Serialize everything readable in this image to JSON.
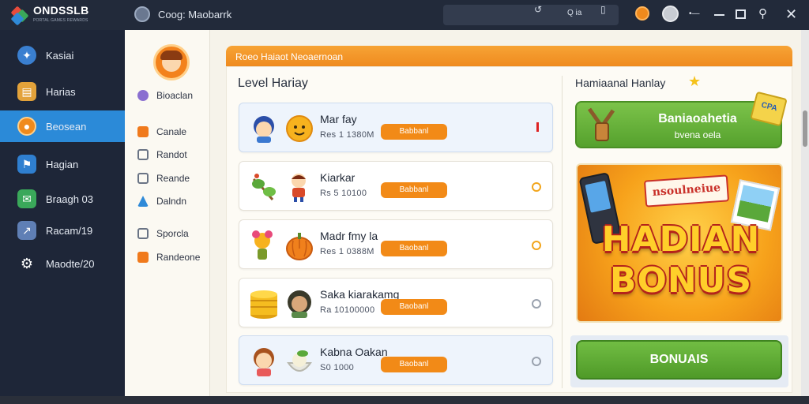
{
  "app": {
    "logo_name": "ONDSSLB",
    "logo_sub": "PORTAL GAMES REWARDS",
    "tab_title": "Coog: Maobarrk",
    "search_text": "Q ia"
  },
  "nav": {
    "items": [
      {
        "label": "Kasiai",
        "icon": "gamepad-icon",
        "color": "#3a7fd0"
      },
      {
        "label": "Harias",
        "icon": "chest-icon",
        "color": "#e3a23a"
      },
      {
        "label": "Beosean",
        "icon": "coin-icon",
        "color": "#f08a1c",
        "active": true
      },
      {
        "label": "Hagian",
        "icon": "flag-icon",
        "color": "#2f7fd0"
      },
      {
        "label": "Braagh 03",
        "icon": "mail-icon",
        "color": "#3aa85a"
      },
      {
        "label": "Racam/19",
        "icon": "chart-icon",
        "color": "#6a8cc0"
      },
      {
        "label": "Maodte/20",
        "icon": "gear-icon",
        "color": "#e6ebf3"
      }
    ]
  },
  "sub": {
    "items": [
      {
        "label": "Bioaclan",
        "icon": "profile-icon",
        "color": "#8a6fd0"
      },
      {
        "label": "Canale",
        "icon": "star-icon",
        "color": "#f07a1c"
      },
      {
        "label": "Randot",
        "icon": "doc-icon",
        "color": "#6a7485"
      },
      {
        "label": "Reande",
        "icon": "list-icon",
        "color": "#6a7485"
      },
      {
        "label": "Dalndn",
        "icon": "triangle-icon",
        "color": "#2f8ad8"
      },
      {
        "label": "Sporcla",
        "icon": "bar-icon",
        "color": "#6a7485"
      },
      {
        "label": "Randeone",
        "icon": "gift-icon",
        "color": "#f07a1c"
      }
    ]
  },
  "banner": "Roeo Haiaot Neoaernoan",
  "levels": {
    "title": "Level Hariay",
    "rows": [
      {
        "name": "Mar fay",
        "points": "Res 1 1380M",
        "button": "Babbanl",
        "mark_color": "#d22",
        "highlight": true
      },
      {
        "name": "Kiarkar",
        "points": "Rs 5 10100",
        "button": "Babbanl",
        "mark_color": "#f2a51c",
        "highlight": false
      },
      {
        "name": "Madr fmy la",
        "points": "Res 1 0388M",
        "button": "Baobanl",
        "mark_color": "#f2a51c",
        "highlight": false
      },
      {
        "name": "Saka kiarakamg",
        "points": "Ra 10100000",
        "button": "Baobanl",
        "mark_color": "#9aa2ae",
        "highlight": false
      },
      {
        "name": "Kabna Oakan",
        "points": "S0 1000",
        "button": "Baobanl",
        "mark_color": "#9aa2ae",
        "highlight": true
      }
    ]
  },
  "right": {
    "title": "Hamiaanal Hanlay",
    "green_card_title": "Baniaoahetia",
    "green_card_sub": "bvena oela",
    "ticket_text": "CPA",
    "ribbon": "nsoulneiue",
    "bonus_line1": "HADIAN",
    "bonus_line2": "BONUS",
    "button": "BONUAIS"
  }
}
